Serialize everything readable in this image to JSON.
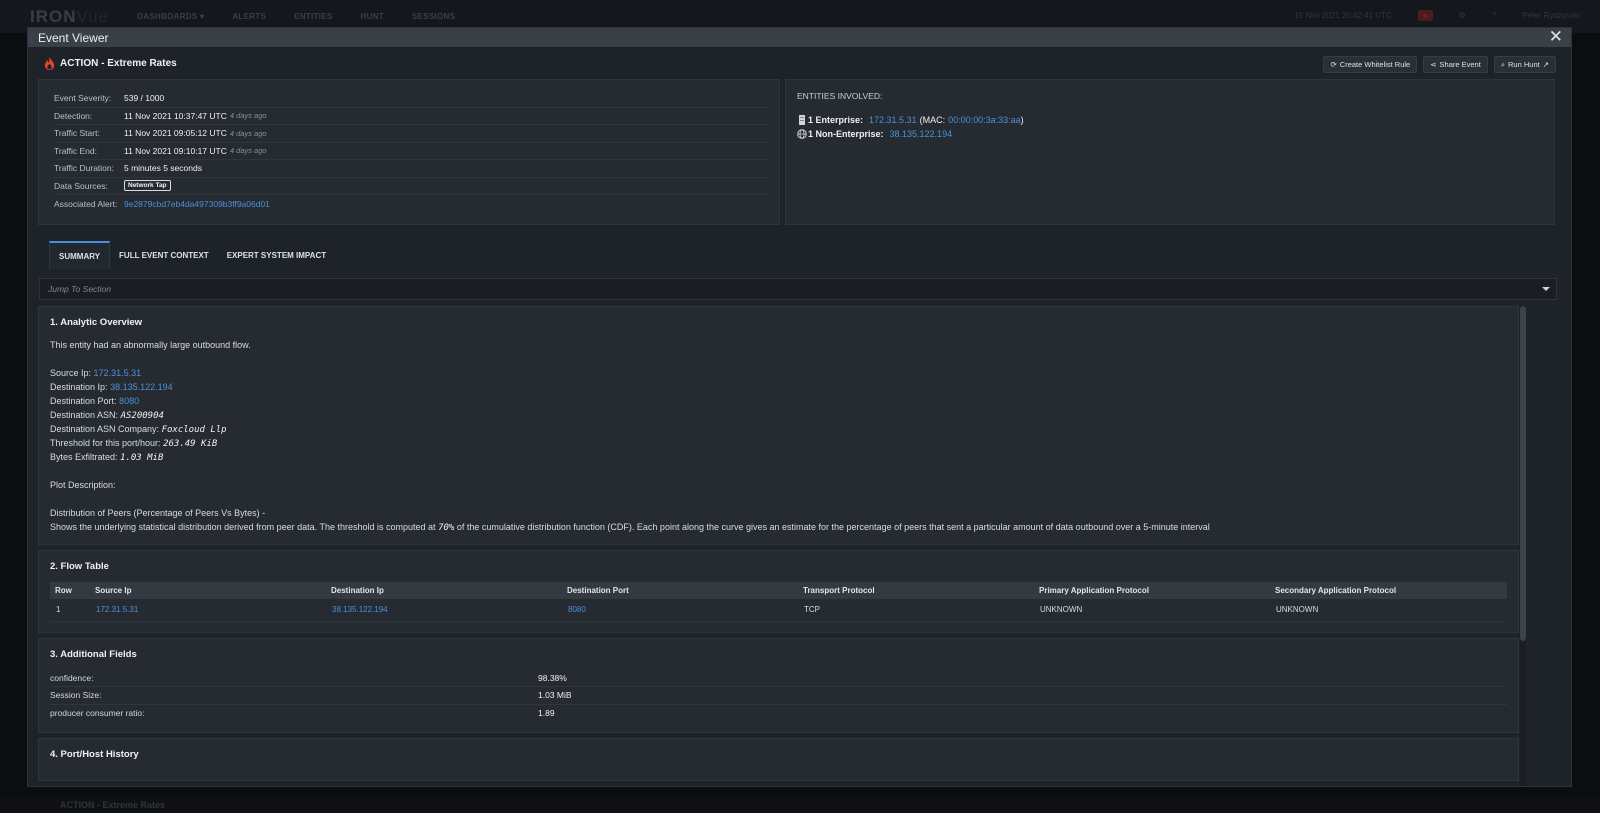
{
  "background": {
    "logo_main": "IRON",
    "logo_sub": "Vue",
    "nav_items": [
      "DASHBOARDS ▾",
      "ALERTS",
      "ENTITIES",
      "HUNT",
      "SESSIONS"
    ],
    "datetime": "15 Nov 2021 20:42:41 UTC",
    "user": "Peter Rydzynski",
    "bottom_title": "ACTION - Extreme Rates"
  },
  "modal": {
    "title": "Event Viewer",
    "close": "✕"
  },
  "event": {
    "title": "ACTION - Extreme Rates",
    "actions": {
      "whitelist": "Create Whitelist Rule",
      "share": "Share Event",
      "hunt": "Run Hunt"
    }
  },
  "details": {
    "severity_label": "Event Severity:",
    "severity_value": "539 / 1000",
    "detection_label": "Detection:",
    "detection_value": "11 Nov 2021 10:37:47 UTC",
    "detection_ago": "4 days ago",
    "start_label": "Traffic Start:",
    "start_value": "11 Nov 2021 09:05:12 UTC",
    "start_ago": "4 days ago",
    "end_label": "Traffic End:",
    "end_value": "11 Nov 2021 09:10:17 UTC",
    "end_ago": "4 days ago",
    "duration_label": "Traffic Duration:",
    "duration_value": "5 minutes 5 seconds",
    "sources_label": "Data Sources:",
    "sources_tag": "Network Tap",
    "alert_label": "Associated Alert:",
    "alert_value": "9e2879cbd7eb4da497309b3ff9a06d01"
  },
  "entities": {
    "heading": "ENTITIES INVOLVED:",
    "enterprise_label": "1 Enterprise:",
    "enterprise_ip": "172.31.5.31",
    "enterprise_mac_prefix": "(MAC:",
    "enterprise_mac": "00:00:00:3a:33:aa",
    "enterprise_mac_suffix": ")",
    "nonenterprise_label": "1 Non-Enterprise:",
    "nonenterprise_ip": "38.135.122.194"
  },
  "tabs": [
    "SUMMARY",
    "FULL EVENT CONTEXT",
    "EXPERT SYSTEM IMPACT"
  ],
  "jump": {
    "placeholder": "Jump To Section"
  },
  "overview": {
    "title": "1. Analytic Overview",
    "intro": "This entity had an abnormally large outbound flow.",
    "source_ip_label": "Source Ip:",
    "source_ip": "172.31.5.31",
    "dest_ip_label": "Destination Ip:",
    "dest_ip": "38.135.122.194",
    "dest_port_label": "Destination Port:",
    "dest_port": "8080",
    "asn_label": "Destination ASN:",
    "asn": "AS200904",
    "asn_company_label": "Destination ASN Company:",
    "asn_company": "Foxcloud Llp",
    "threshold_label": "Threshold for this port/hour:",
    "threshold": "263.49 KiB",
    "bytes_label": "Bytes Exfiltrated:",
    "bytes": "1.03 MiB",
    "plot_label": "Plot Description:",
    "dist_title": "Distribution of Peers (Percentage of Peers Vs Bytes) -",
    "desc_pre": "Shows the underlying statistical distribution derived from peer data. The threshold is computed at",
    "desc_pct": "70%",
    "desc_post": "of the cumulative distribution function (CDF). Each point along the curve gives an estimate for the percentage of peers that sent a particular amount of data outbound over a 5-minute interval"
  },
  "flow": {
    "title": "2. Flow Table",
    "headers": [
      "Row",
      "Source Ip",
      "Destination Ip",
      "Destination Port",
      "Transport Protocol",
      "Primary Application Protocol",
      "Secondary Application Protocol"
    ],
    "rows": [
      [
        "1",
        "172.31.5.31",
        "38.135.122.194",
        "8080",
        "TCP",
        "UNKNOWN",
        "UNKNOWN"
      ]
    ]
  },
  "additional": {
    "title": "3. Additional Fields",
    "fields": [
      {
        "k": "confidence:",
        "v": "98.38%"
      },
      {
        "k": "Session Size:",
        "v": "1.03 MiB"
      },
      {
        "k": "producer consumer ratio:",
        "v": "1.89"
      }
    ]
  },
  "history": {
    "title": "4. Port/Host History"
  },
  "colors": {
    "accent": "#4a90d9",
    "fire": "#e8452c",
    "panel": "#262b31"
  }
}
